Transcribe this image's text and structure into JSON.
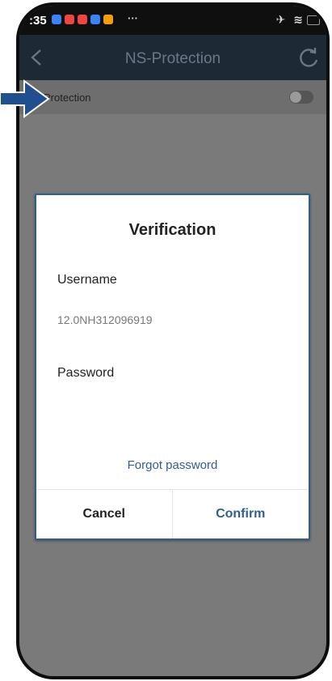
{
  "status_bar": {
    "time": ":35",
    "overflow": "···",
    "notification_colors": [
      "#3b82f6",
      "#ef4444",
      "#ef4444",
      "#3b82f6",
      "#f59e0b"
    ]
  },
  "header": {
    "title": "NS-Protection",
    "back_icon": "chevron-left-icon",
    "refresh_icon": "refresh-icon"
  },
  "setting": {
    "label": "Protection",
    "toggle_on": false
  },
  "dialog": {
    "title": "Verification",
    "username_label": "Username",
    "username_value": "12.0NH312096919",
    "password_label": "Password",
    "password_value": "",
    "forgot_link": "Forgot password",
    "cancel_label": "Cancel",
    "confirm_label": "Confirm"
  },
  "colors": {
    "accent": "#2f5e94",
    "app_bar": "#1d2935",
    "annotation_arrow": "#1f4f8f"
  }
}
